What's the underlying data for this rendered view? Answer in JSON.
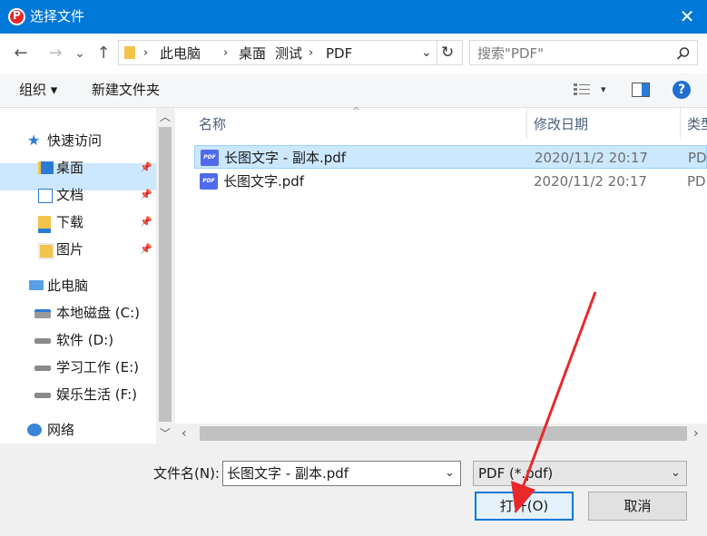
{
  "window": {
    "title": "选择文件",
    "close_glyph": "✕"
  },
  "nav": {
    "back": "←",
    "forward": "→",
    "recent": "⌄",
    "up": "↑",
    "breadcrumbs": [
      "此电脑",
      "桌面",
      "测试",
      "PDF"
    ],
    "refresh": "↻",
    "dropdown": "⌄",
    "search_placeholder": "搜索\"PDF\""
  },
  "toolbar": {
    "organize": "组织 ▾",
    "new_folder": "新建文件夹",
    "help": "?"
  },
  "sidebar": {
    "quick_access": "快速访问",
    "items": [
      {
        "label": "桌面",
        "icon": "desktop-folder-icon"
      },
      {
        "label": "文档",
        "icon": "documents-folder-icon"
      },
      {
        "label": "下载",
        "icon": "downloads-folder-icon"
      },
      {
        "label": "图片",
        "icon": "pictures-folder-icon"
      }
    ],
    "this_pc": "此电脑",
    "drives": [
      {
        "label": "本地磁盘 (C:)"
      },
      {
        "label": "软件 (D:)"
      },
      {
        "label": "学习工作 (E:)"
      },
      {
        "label": "娱乐生活 (F:)"
      }
    ],
    "network": "网络"
  },
  "filelist": {
    "columns": {
      "name": "名称",
      "date": "修改日期",
      "type": "类型"
    },
    "rows": [
      {
        "name": "长图文字 - 副本.pdf",
        "date": "2020/11/2 20:17",
        "type": "PDF",
        "selected": true
      },
      {
        "name": "长图文字.pdf",
        "date": "2020/11/2 20:17",
        "type": "PDF",
        "selected": false
      }
    ],
    "pdf_badge": "PDF"
  },
  "bottom": {
    "filename_label": "文件名(N):",
    "filename_value": "长图文字 - 副本.pdf",
    "filetype_value": "PDF (*.pdf)",
    "open_label": "打开(O)",
    "cancel_label": "取消"
  },
  "colors": {
    "title_bar": "#0078d7",
    "selection": "#cce8ff",
    "annotation_arrow": "#e8282b"
  }
}
